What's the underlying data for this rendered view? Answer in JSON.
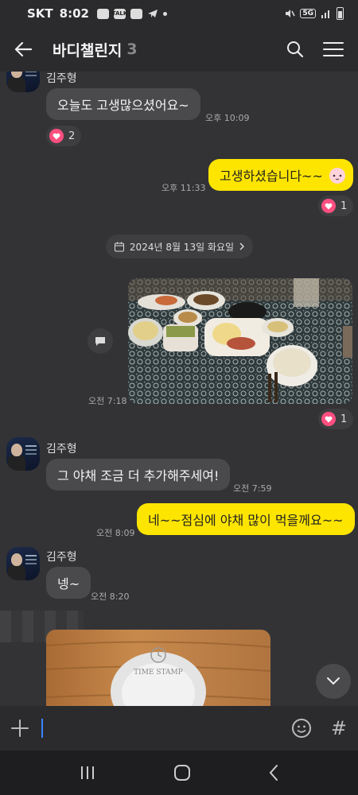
{
  "status_bar": {
    "carrier": "SKT",
    "time": "8:02",
    "notification_icons": [
      "message-icon",
      "talk-icon",
      "gallery-icon",
      "telegram-icon"
    ],
    "network": "5G"
  },
  "header": {
    "title": "바디챌린지",
    "member_count": "3"
  },
  "messages": [
    {
      "sender": "김주형",
      "text": "오늘도 고생많으셨어요~",
      "time": "오후 10:09",
      "reaction_count": "2"
    },
    {
      "text": "고생하셨습니다~~",
      "time": "오후 11:33",
      "reaction_count": "1"
    },
    {
      "date_divider": "2024년 8월 13일 화요일"
    },
    {
      "photo_time": "오전 7:18",
      "reaction_count": "1"
    },
    {
      "sender": "김주형",
      "text": "그 야채 조금 더 추가해주세여!",
      "time": "오전 7:59"
    },
    {
      "text": "네~~점심에 야채 많이 먹을께요~~",
      "time": "오전 8:09"
    },
    {
      "sender": "김주형",
      "text": "넹~",
      "time": "오전 8:20"
    },
    {
      "photo_watermark": "TIME STAMP"
    }
  ],
  "input": {
    "plus_icon": "plus-icon",
    "emoji_icon": "emoji-icon",
    "hash_label": "#"
  },
  "colors": {
    "background": "#333336",
    "my_bubble": "#fee500",
    "other_bubble": "#4a4a4d",
    "heart": "#ff4f80",
    "caret": "#3b82ff"
  }
}
